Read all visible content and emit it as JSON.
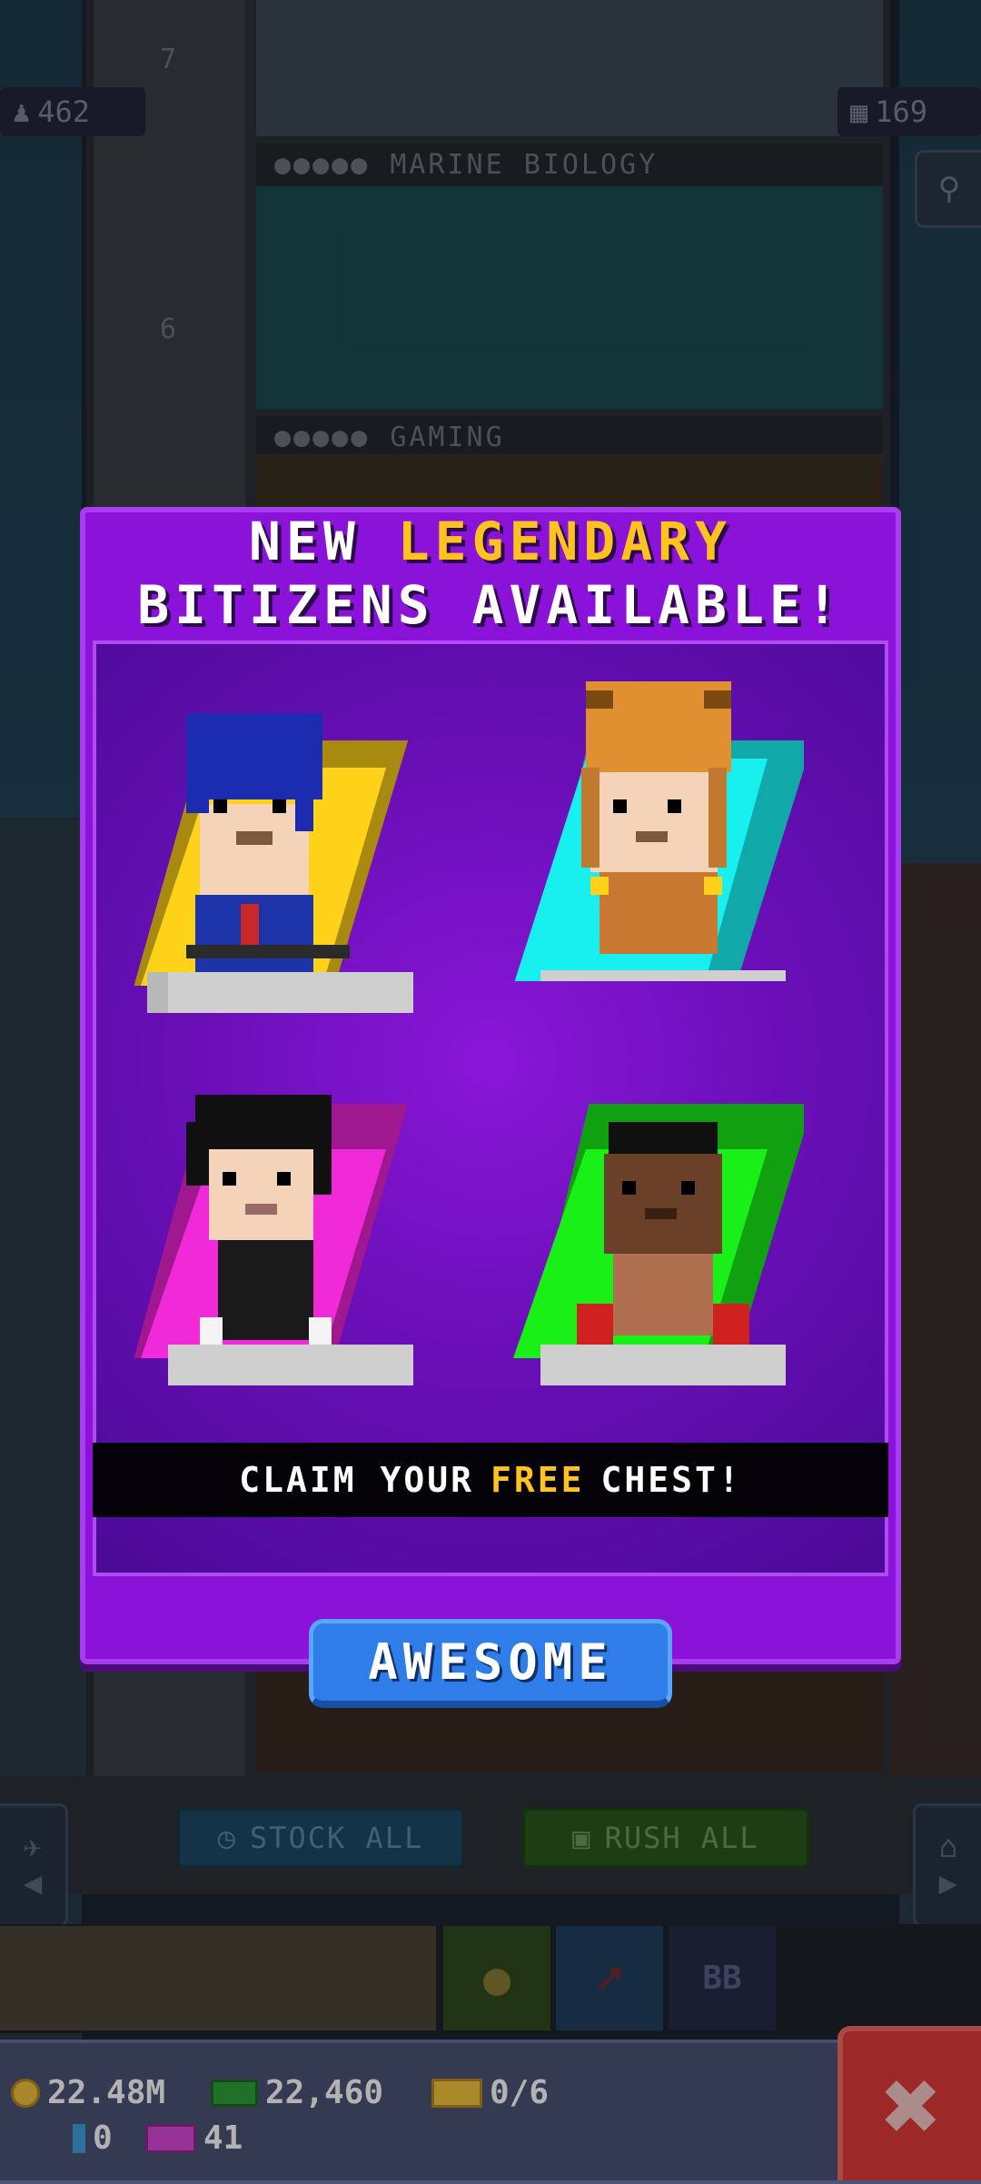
{
  "hud": {
    "population": "462",
    "floors_count": "169"
  },
  "floors": [
    {
      "number": "7",
      "label": "MARINE BIOLOGY"
    },
    {
      "number": "6",
      "label": "GAMING"
    }
  ],
  "popup": {
    "title_prefix": "NEW",
    "title_highlight": "LEGENDARY",
    "title_line2": "BITIZENS AVAILABLE!",
    "claim_prefix": "CLAIM YOUR",
    "claim_highlight": "FREE",
    "claim_suffix": "CHEST!",
    "button_label": "AWESOME",
    "bitizens": [
      {
        "name": "hockey-player",
        "card_color": "#ffd21a",
        "card_shadow": "#a88a10"
      },
      {
        "name": "tiger-hood-girl",
        "card_color": "#18f0f0",
        "card_shadow": "#10a8a8"
      },
      {
        "name": "goth-bitizen",
        "card_color": "#f02ad8",
        "card_shadow": "#a01890"
      },
      {
        "name": "boxer",
        "card_color": "#18f018",
        "card_shadow": "#10a010"
      }
    ]
  },
  "controls": {
    "stock_all": "STOCK ALL",
    "rush_all": "RUSH ALL",
    "bb_label": "BB"
  },
  "status": {
    "coins": "22.48M",
    "bux": "22,460",
    "tickets": "0/6",
    "gems": "0",
    "vip_tickets": "41"
  },
  "colors": {
    "popup_bg": "#8a12d9",
    "accent_yellow": "#ffc21e",
    "button_blue": "#2f7de8",
    "close_red": "#e03a3a"
  }
}
